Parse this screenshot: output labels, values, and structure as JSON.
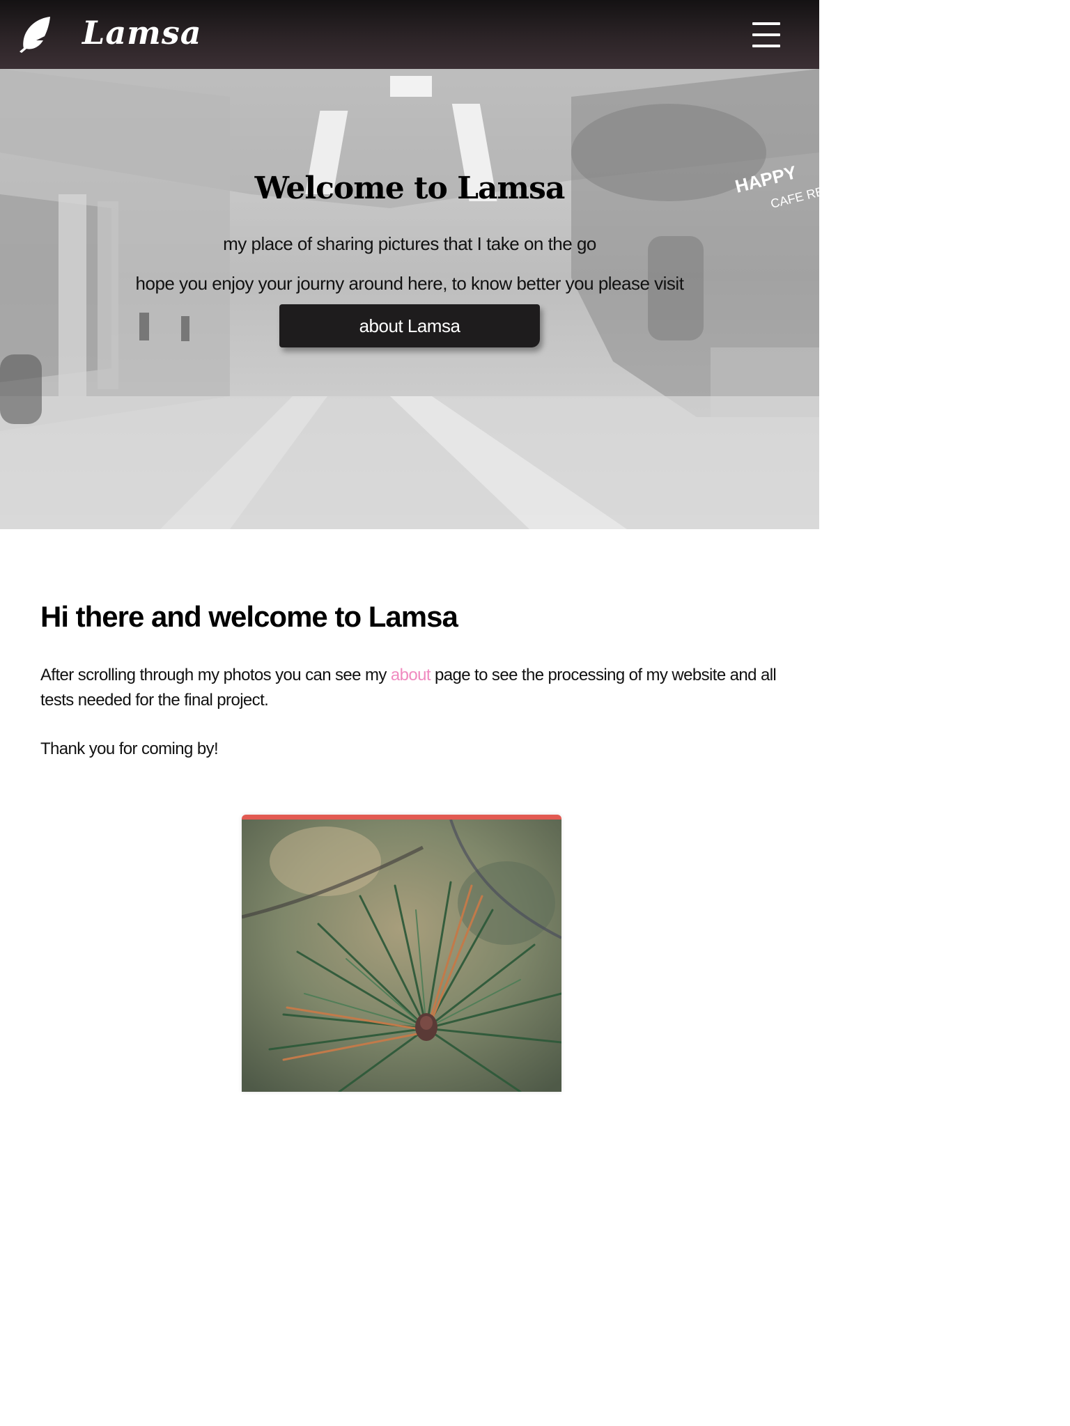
{
  "navbar": {
    "brand": "Lamsa",
    "logo_icon": "feather-icon",
    "menu_icon": "hamburger-menu-icon"
  },
  "hero": {
    "title": "Welcome to Lamsa",
    "line1": "my place of sharing pictures that I take on the go",
    "line2": "hope you enjoy your journy around here, to know better you please visit",
    "button_label": "about Lamsa"
  },
  "content": {
    "heading": "Hi there and welcome to Lamsa",
    "para_before": "After scrolling through my photos you can see my ",
    "para_link": "about",
    "para_after": " page to see the processing of my website and all tests needed for the final project.",
    "thanks": "Thank you for coming by!"
  },
  "colors": {
    "nav_bg": "#2c2427",
    "link": "#f08ac0",
    "card_accent": "#e25a52",
    "button_bg": "#1e1c1d"
  }
}
